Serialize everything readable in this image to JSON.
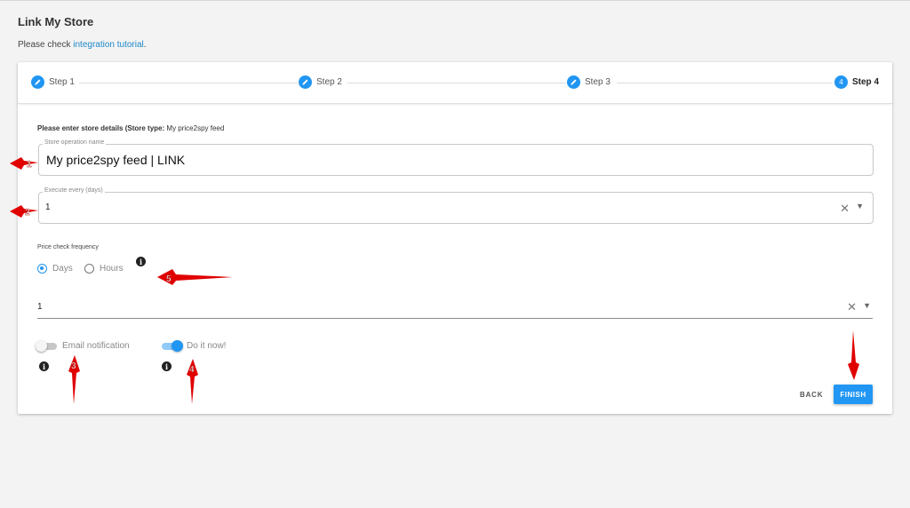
{
  "page": {
    "title": "Link My Store",
    "tutorial_prefix": "Please check ",
    "tutorial_link": "integration tutorial",
    "tutorial_suffix": "."
  },
  "stepper": {
    "steps": [
      {
        "label": "Step 1",
        "icon": "pencil-icon"
      },
      {
        "label": "Step 2",
        "icon": "pencil-icon"
      },
      {
        "label": "Step 3",
        "icon": "pencil-icon"
      },
      {
        "label": "Step 4",
        "number": "4"
      }
    ]
  },
  "form": {
    "details_label": "Please enter store details (Store type:",
    "store_type": "My price2spy feed",
    "store_name": {
      "label": "Store operation name",
      "value": "My price2spy feed | LINK"
    },
    "execute_every": {
      "label": "Execute every (days)",
      "value": "1"
    },
    "price_check": {
      "label": "Price check frequency",
      "options": [
        "Days",
        "Hours"
      ],
      "selected": "Days",
      "value": "1"
    },
    "email_notification": {
      "label": "Email notification",
      "on": false
    },
    "do_it_now": {
      "label": "Do it now!",
      "on": true
    }
  },
  "actions": {
    "back": "BACK",
    "finish": "FINISH"
  },
  "annotations": [
    "1",
    "2",
    "3",
    "4",
    "5"
  ],
  "colors": {
    "accent": "#2196f3",
    "link": "#1e88c8",
    "annotation": "#e00000"
  }
}
